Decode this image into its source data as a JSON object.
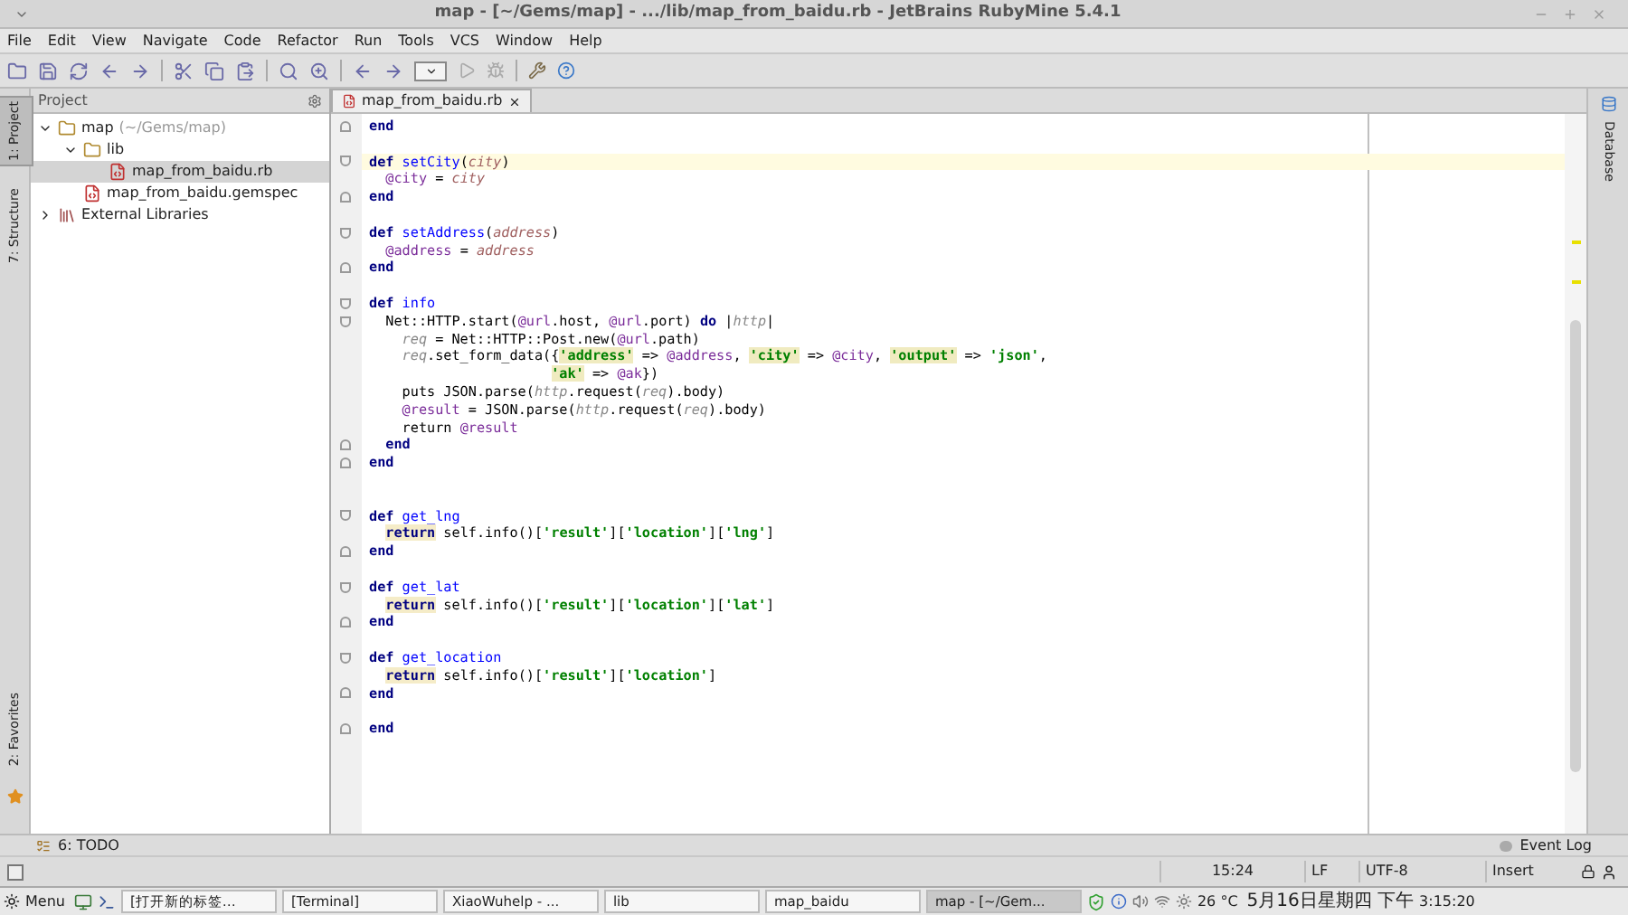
{
  "window": {
    "title": "map - [~/Gems/map] - .../lib/map_from_baidu.rb - JetBrains RubyMine 5.4.1"
  },
  "menu": [
    "File",
    "Edit",
    "View",
    "Navigate",
    "Code",
    "Refactor",
    "Run",
    "Tools",
    "VCS",
    "Window",
    "Help"
  ],
  "left_stripe": [
    {
      "label": "1: Project",
      "selected": true
    },
    {
      "label": "7: Structure",
      "selected": false
    },
    {
      "label": "2: Favorites",
      "selected": false
    }
  ],
  "right_stripe": [
    {
      "label": "Database",
      "selected": false
    }
  ],
  "project_panel": {
    "title": "Project",
    "tree": [
      {
        "label": "map",
        "hint": "(~/Gems/map)",
        "kind": "folder",
        "expanded": true,
        "selected": false,
        "children": [
          {
            "label": "lib",
            "kind": "folder",
            "expanded": true,
            "selected": false,
            "children": [
              {
                "label": "map_from_baidu.rb",
                "kind": "file",
                "selected": true
              }
            ]
          },
          {
            "label": "map_from_baidu.gemspec",
            "kind": "file",
            "selected": false
          }
        ]
      },
      {
        "label": "External Libraries",
        "kind": "library",
        "expanded": false,
        "selected": false
      }
    ]
  },
  "editor": {
    "tabs": [
      {
        "label": "map_from_baidu.rb",
        "selected": true
      }
    ],
    "lines": [
      {
        "fold_end": true,
        "current": false,
        "tokens": [
          {
            "text": "end",
            "kind": "kw"
          }
        ]
      },
      {
        "current": false
      },
      {
        "fold_start": true,
        "current": true,
        "tokens": [
          {
            "text": "def ",
            "kind": "kw"
          },
          {
            "text": "setCity",
            "kind": "fn"
          },
          {
            "text": "(",
            "kind": "plain"
          },
          {
            "text": "city",
            "kind": "param"
          },
          {
            "text": ")",
            "kind": "plain"
          }
        ]
      },
      {
        "current": false,
        "tokens": [
          {
            "text": "  @city",
            "kind": "ivar"
          },
          {
            "text": " = ",
            "kind": "plain"
          },
          {
            "text": "city",
            "kind": "param"
          }
        ]
      },
      {
        "fold_end": true,
        "current": false,
        "tokens": [
          {
            "text": "end",
            "kind": "kw"
          }
        ]
      },
      {
        "current": false
      },
      {
        "fold_start": true,
        "current": false,
        "tokens": [
          {
            "text": "def ",
            "kind": "kw"
          },
          {
            "text": "setAddress",
            "kind": "fn"
          },
          {
            "text": "(",
            "kind": "plain"
          },
          {
            "text": "address",
            "kind": "param"
          },
          {
            "text": ")",
            "kind": "plain"
          }
        ]
      },
      {
        "current": false,
        "tokens": [
          {
            "text": "  @address",
            "kind": "ivar"
          },
          {
            "text": " = ",
            "kind": "plain"
          },
          {
            "text": "address",
            "kind": "param"
          }
        ]
      },
      {
        "fold_end": true,
        "current": false,
        "tokens": [
          {
            "text": "end",
            "kind": "kw"
          }
        ]
      },
      {
        "current": false
      },
      {
        "fold_start": true,
        "current": false,
        "tokens": [
          {
            "text": "def ",
            "kind": "kw"
          },
          {
            "text": "info",
            "kind": "fn"
          }
        ]
      },
      {
        "fold_start": true,
        "current": false,
        "tokens": [
          {
            "text": "  Net::HTTP.start(",
            "kind": "plain"
          },
          {
            "text": "@url",
            "kind": "ivar"
          },
          {
            "text": ".host, ",
            "kind": "plain"
          },
          {
            "text": "@url",
            "kind": "ivar"
          },
          {
            "text": ".port) ",
            "kind": "plain"
          },
          {
            "text": "do",
            "kind": "kw"
          },
          {
            "text": " |",
            "kind": "plain"
          },
          {
            "text": "http",
            "kind": "local"
          },
          {
            "text": "|",
            "kind": "plain"
          }
        ]
      },
      {
        "current": false,
        "tokens": [
          {
            "text": "    req",
            "kind": "local"
          },
          {
            "text": " = Net::HTTP::Post.new(",
            "kind": "plain"
          },
          {
            "text": "@url",
            "kind": "ivar"
          },
          {
            "text": ".path)",
            "kind": "plain"
          }
        ]
      },
      {
        "current": false,
        "tokens": [
          {
            "text": "    req",
            "kind": "local"
          },
          {
            "text": ".set_form_data({",
            "kind": "plain"
          },
          {
            "text": "'address'",
            "kind": "key"
          },
          {
            "text": " => ",
            "kind": "plain"
          },
          {
            "text": "@address",
            "kind": "ivar"
          },
          {
            "text": ", ",
            "kind": "plain"
          },
          {
            "text": "'city'",
            "kind": "key"
          },
          {
            "text": " => ",
            "kind": "plain"
          },
          {
            "text": "@city",
            "kind": "ivar"
          },
          {
            "text": ", ",
            "kind": "plain"
          },
          {
            "text": "'output'",
            "kind": "key"
          },
          {
            "text": " => ",
            "kind": "plain"
          },
          {
            "text": "'json'",
            "kind": "str"
          },
          {
            "text": ",",
            "kind": "plain"
          }
        ]
      },
      {
        "current": false,
        "tokens": [
          {
            "text": "                      'ak'",
            "kind": "key"
          },
          {
            "text": " => ",
            "kind": "plain"
          },
          {
            "text": "@ak",
            "kind": "ivar"
          },
          {
            "text": "})",
            "kind": "plain"
          }
        ]
      },
      {
        "current": false,
        "tokens": [
          {
            "text": "    puts JSON.parse(",
            "kind": "plain"
          },
          {
            "text": "http",
            "kind": "local"
          },
          {
            "text": ".request(",
            "kind": "plain"
          },
          {
            "text": "req",
            "kind": "local"
          },
          {
            "text": ").body)",
            "kind": "plain"
          }
        ]
      },
      {
        "current": false,
        "tokens": [
          {
            "text": "    @result",
            "kind": "ivar"
          },
          {
            "text": " = JSON.parse(",
            "kind": "plain"
          },
          {
            "text": "http",
            "kind": "local"
          },
          {
            "text": ".request(",
            "kind": "plain"
          },
          {
            "text": "req",
            "kind": "local"
          },
          {
            "text": ").body)",
            "kind": "plain"
          }
        ]
      },
      {
        "current": false,
        "tokens": [
          {
            "text": "    return ",
            "kind": "plain"
          },
          {
            "text": "@result",
            "kind": "ivar"
          }
        ]
      },
      {
        "fold_end": true,
        "current": false,
        "tokens": [
          {
            "text": "  end",
            "kind": "kw"
          }
        ]
      },
      {
        "fold_end": true,
        "current": false,
        "tokens": [
          {
            "text": "end",
            "kind": "kw"
          }
        ]
      },
      {
        "current": false
      },
      {
        "current": false
      },
      {
        "fold_start": true,
        "current": false,
        "tokens": [
          {
            "text": "def ",
            "kind": "kw"
          },
          {
            "text": "get_lng",
            "kind": "fn"
          }
        ]
      },
      {
        "current": false,
        "tokens": [
          {
            "text": "  return",
            "kind": "kwmarked"
          },
          {
            "text": " self.info()[",
            "kind": "plain"
          },
          {
            "text": "'result'",
            "kind": "str"
          },
          {
            "text": "][",
            "kind": "plain"
          },
          {
            "text": "'location'",
            "kind": "str"
          },
          {
            "text": "][",
            "kind": "plain"
          },
          {
            "text": "'lng'",
            "kind": "str"
          },
          {
            "text": "]",
            "kind": "plain"
          }
        ]
      },
      {
        "fold_end": true,
        "current": false,
        "tokens": [
          {
            "text": "end",
            "kind": "kw"
          }
        ]
      },
      {
        "current": false
      },
      {
        "fold_start": true,
        "current": false,
        "tokens": [
          {
            "text": "def ",
            "kind": "kw"
          },
          {
            "text": "get_lat",
            "kind": "fn"
          }
        ]
      },
      {
        "current": false,
        "tokens": [
          {
            "text": "  return",
            "kind": "kwmarked"
          },
          {
            "text": " self.info()[",
            "kind": "plain"
          },
          {
            "text": "'result'",
            "kind": "str"
          },
          {
            "text": "][",
            "kind": "plain"
          },
          {
            "text": "'location'",
            "kind": "str"
          },
          {
            "text": "][",
            "kind": "plain"
          },
          {
            "text": "'lat'",
            "kind": "str"
          },
          {
            "text": "]",
            "kind": "plain"
          }
        ]
      },
      {
        "fold_end": true,
        "current": false,
        "tokens": [
          {
            "text": "end",
            "kind": "kw"
          }
        ]
      },
      {
        "current": false
      },
      {
        "fold_start": true,
        "current": false,
        "tokens": [
          {
            "text": "def ",
            "kind": "kw"
          },
          {
            "text": "get_location",
            "kind": "fn"
          }
        ]
      },
      {
        "current": false,
        "tokens": [
          {
            "text": "  return",
            "kind": "kwmarked"
          },
          {
            "text": " self.info()[",
            "kind": "plain"
          },
          {
            "text": "'result'",
            "kind": "str"
          },
          {
            "text": "][",
            "kind": "plain"
          },
          {
            "text": "'location'",
            "kind": "str"
          },
          {
            "text": "]",
            "kind": "plain"
          }
        ]
      },
      {
        "fold_end": true,
        "current": false,
        "tokens": [
          {
            "text": "end",
            "kind": "kw"
          }
        ]
      },
      {
        "current": false
      },
      {
        "fold_end": true,
        "current": false,
        "tokens": [
          {
            "text": "end",
            "kind": "kw"
          }
        ]
      }
    ]
  },
  "tool_bar": {
    "left": "6: TODO",
    "right": "Event Log"
  },
  "status_bar": {
    "position": "15:24",
    "line_separator": "LF",
    "encoding": "UTF-8",
    "mode": "Insert"
  },
  "taskbar": {
    "menu": "Menu",
    "tasks": [
      {
        "label": "[打开新的标签…",
        "selected": false
      },
      {
        "label": "[Terminal]",
        "selected": false
      },
      {
        "label": "XiaoWuhelp - ...",
        "selected": false
      },
      {
        "label": "lib",
        "selected": false
      },
      {
        "label": "map_baidu",
        "selected": false
      },
      {
        "label": "map - [~/Gem...",
        "selected": true
      }
    ],
    "temperature": "26 °C",
    "date": "5月16日星期四 下午",
    "time": "3:15:20"
  }
}
